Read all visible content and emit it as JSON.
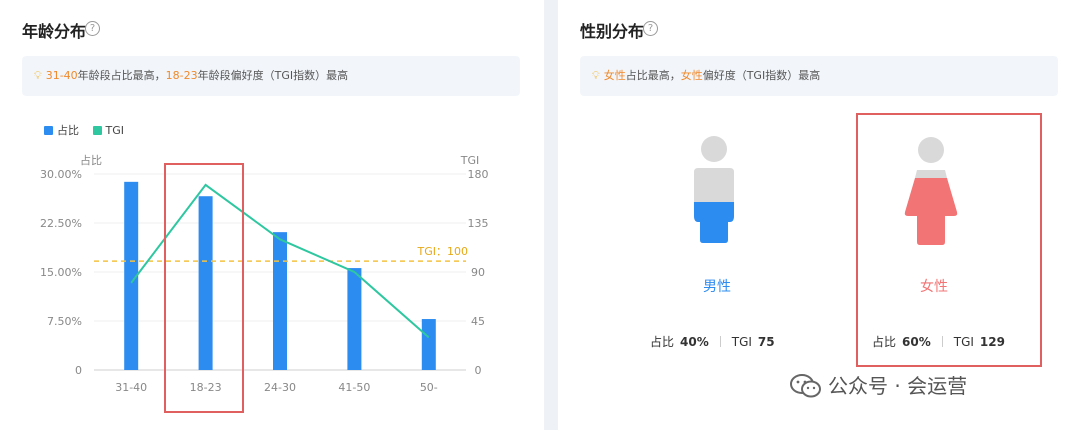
{
  "age": {
    "title": "年龄分布",
    "help": "?",
    "tip": {
      "hl1": "31-40",
      "t1": "年龄段占比最高，",
      "hl2": "18-23",
      "t2": "年龄段偏好度（TGI指数）最高"
    },
    "legend": {
      "share": "占比",
      "tgi": "TGI"
    }
  },
  "gender": {
    "title": "性别分布",
    "help": "?",
    "tip": {
      "hl1": "女性",
      "t1": "占比最高，",
      "hl2": "女性",
      "t2": "偏好度（TGI指数）最高"
    },
    "male": {
      "label": "男性",
      "share_label": "占比",
      "share": "40%",
      "tgi_label": "TGI",
      "tgi": "75"
    },
    "female": {
      "label": "女性",
      "share_label": "占比",
      "share": "60%",
      "tgi_label": "TGI",
      "tgi": "129"
    }
  },
  "watermark": "公众号 · 会运营",
  "colors": {
    "bar": "#2d8cf0",
    "tgi": "#2ec7a0",
    "ref": "#f5c242",
    "male": "#2d8cf0",
    "female": "#f27474",
    "figure": "#d9d9d9",
    "highlight": "#f0892b",
    "box": "#e0605f"
  },
  "chart_data": {
    "type": "bar",
    "categories": [
      "31-40",
      "18-23",
      "24-30",
      "41-50",
      "50-"
    ],
    "series": [
      {
        "name": "占比",
        "axis": "left",
        "values": [
          28.8,
          26.6,
          21.1,
          15.6,
          7.8
        ]
      },
      {
        "name": "TGI",
        "axis": "right",
        "type": "line",
        "values": [
          80,
          170,
          120,
          90,
          30
        ]
      }
    ],
    "left_axis": {
      "title": "占比",
      "ticks": [
        "30.00%",
        "22.50%",
        "15.00%",
        "7.50%",
        "0"
      ],
      "range": [
        0,
        30
      ]
    },
    "right_axis": {
      "title": "TGI",
      "ticks": [
        "180",
        "135",
        "90",
        "45",
        "0"
      ],
      "range": [
        0,
        180
      ]
    },
    "reference_line": {
      "label": "TGI：100",
      "value": 100
    },
    "legend_position": "top-left",
    "highlighted_category": "18-23"
  }
}
